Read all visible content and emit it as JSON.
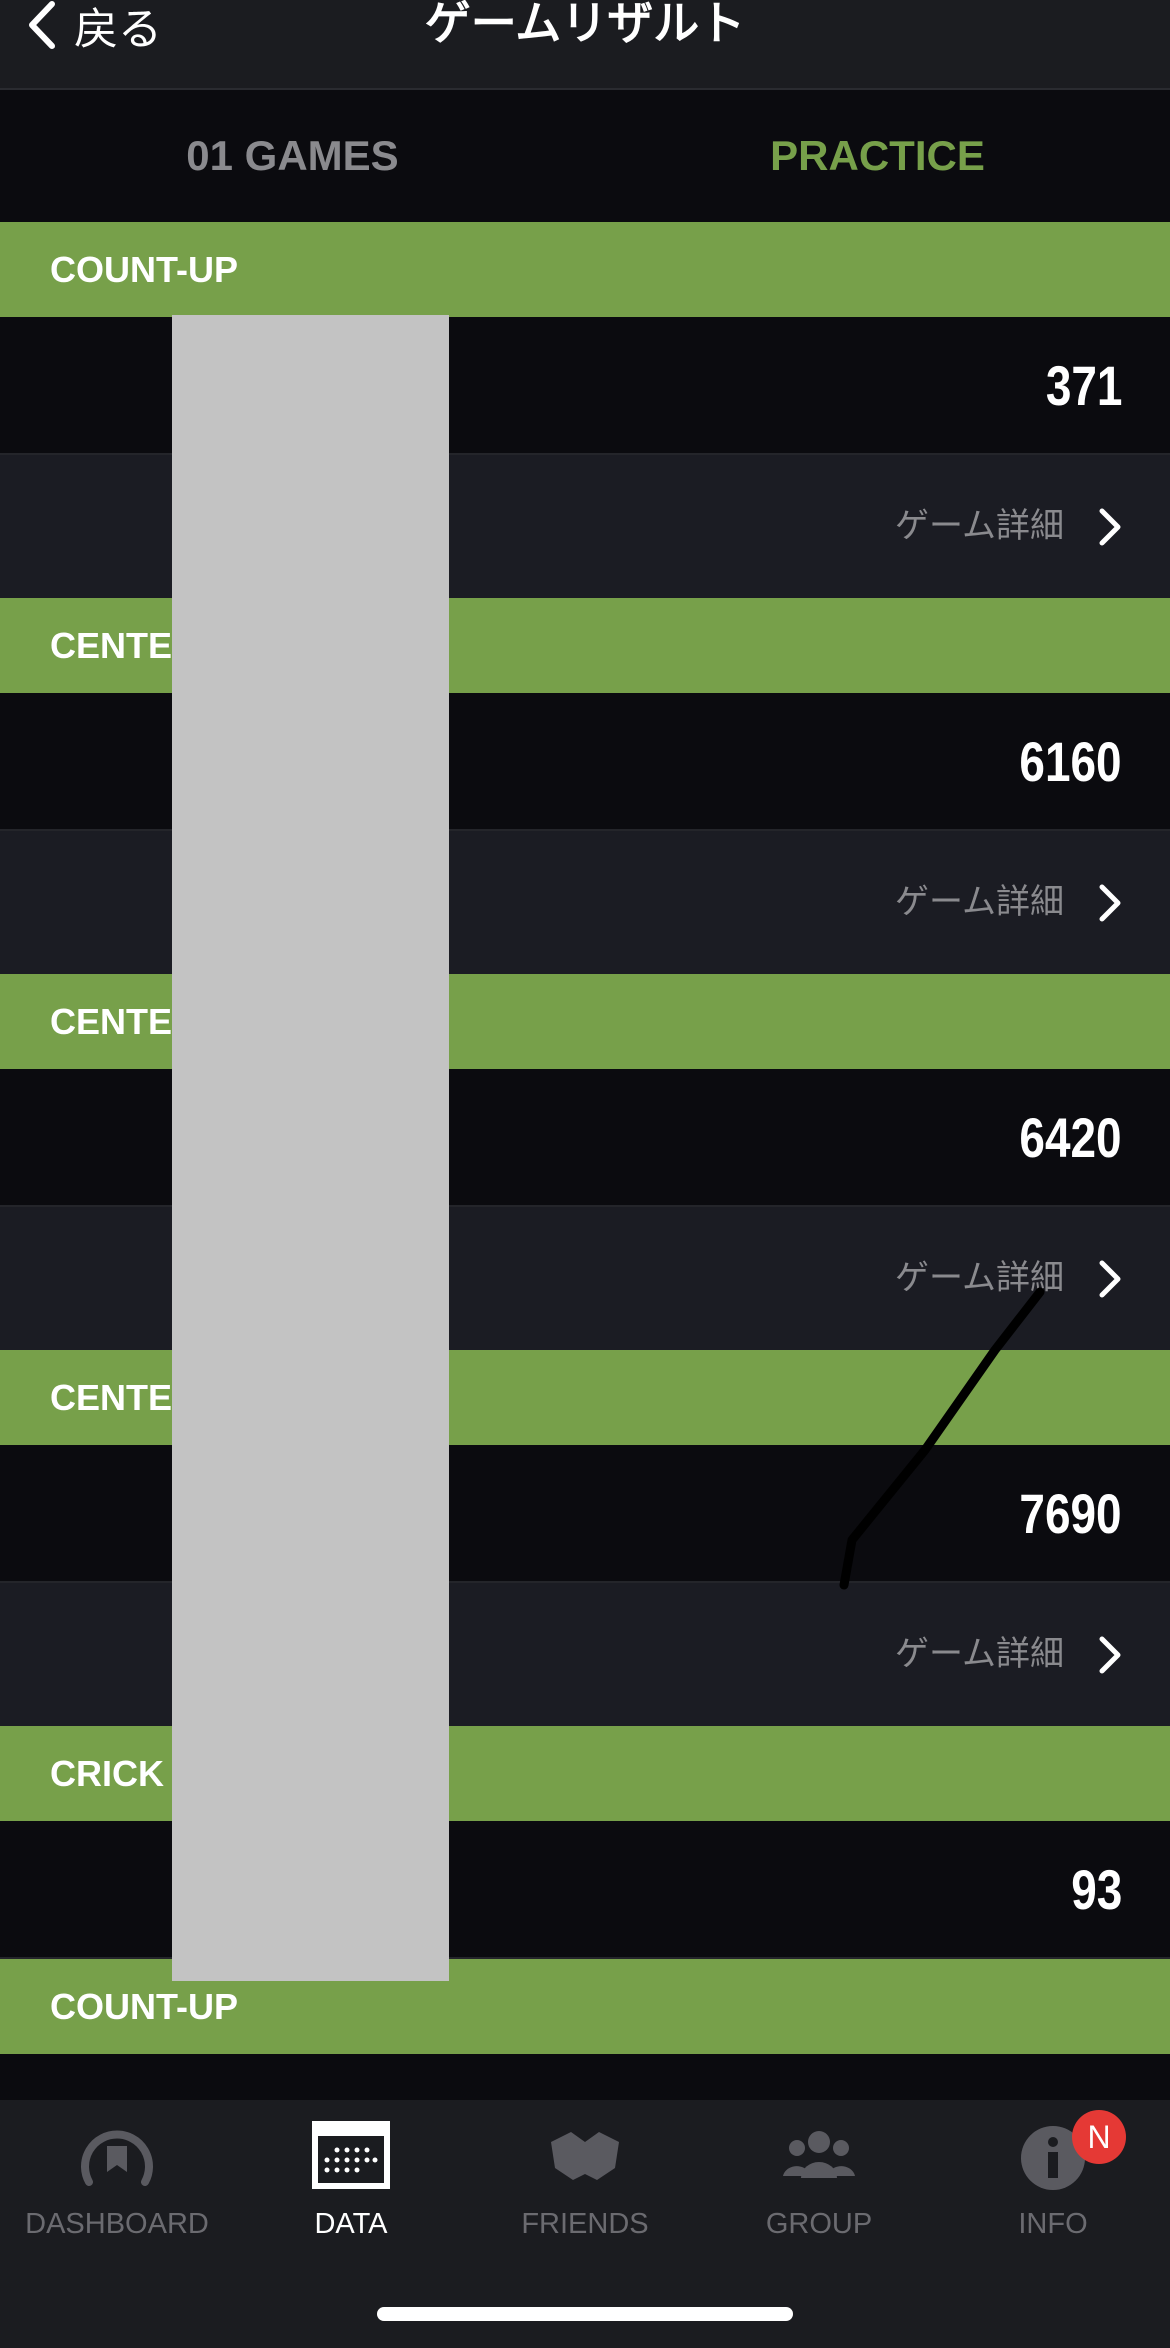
{
  "header": {
    "back_label": "戻る",
    "title": "ゲームリザルト"
  },
  "tabs": [
    {
      "label": "01 GAMES"
    },
    {
      "label": "PRACTICE"
    }
  ],
  "colors": {
    "accent": "#77a04a",
    "background": "#0b0b0f",
    "row_alt": "#1b1c23",
    "badge": "#e53935"
  },
  "results": [
    {
      "game": "COUNT-UP",
      "score": "371",
      "detail_label": "ゲーム詳細"
    },
    {
      "game": "CENTE",
      "score": "6160",
      "detail_label": "ゲーム詳細"
    },
    {
      "game": "CENTE",
      "score": "6420",
      "detail_label": "ゲーム詳細"
    },
    {
      "game": "CENTE",
      "score": "7690",
      "detail_label": "ゲーム詳細"
    },
    {
      "game": "CRICK",
      "score": "93"
    },
    {
      "game": "COUNT-UP"
    }
  ],
  "tabbar": [
    {
      "label": "DASHBOARD",
      "icon": "gauge-icon"
    },
    {
      "label": "DATA",
      "icon": "calendar-grid-icon",
      "active": true
    },
    {
      "label": "FRIENDS",
      "icon": "handshake-icon"
    },
    {
      "label": "GROUP",
      "icon": "group-icon"
    },
    {
      "label": "INFO",
      "icon": "info-icon",
      "badge": "N"
    }
  ]
}
